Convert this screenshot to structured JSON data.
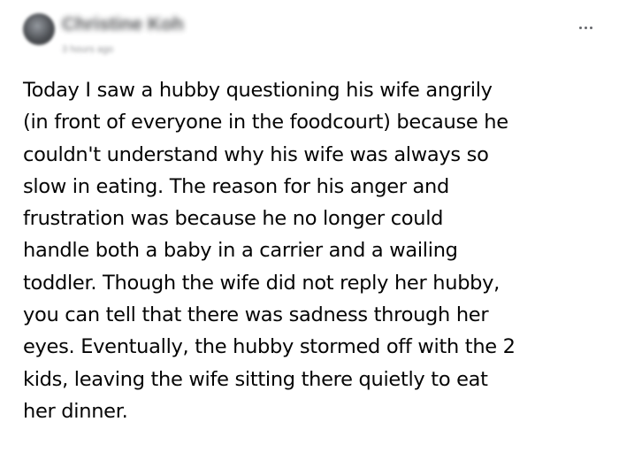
{
  "post": {
    "author_name": "Christine Koh",
    "meta": "3 hours ago",
    "more_icon": "more-horizontal-icon",
    "body_lines": [
      "Today I saw a hubby questioning his wife angrily",
      "(in front of everyone in the foodcourt) because he",
      "couldn't understand why his wife was always so",
      "slow in eating. The reason for his anger and",
      "frustration was because he no longer could",
      "handle both a baby in a carrier and a wailing",
      "toddler. Though the wife did not reply her hubby,",
      "you can tell that there was sadness through her",
      "eyes. Eventually, the hubby stormed off with the 2",
      "kids, leaving the wife sitting there quietly to eat",
      "her dinner."
    ]
  }
}
